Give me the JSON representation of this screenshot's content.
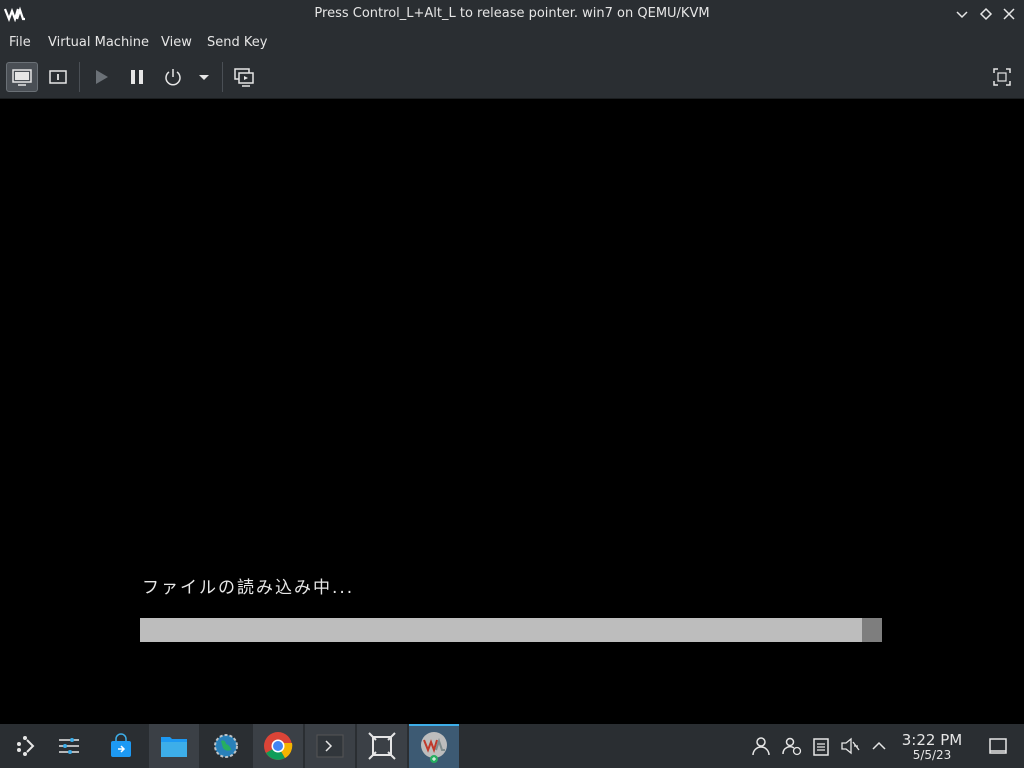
{
  "window": {
    "title": "Press Control_L+Alt_L to release pointer. win7 on QEMU/KVM",
    "app_icon": "virt-manager-icon",
    "controls": [
      "minimize-icon",
      "maximize-icon",
      "close-icon"
    ]
  },
  "menubar": {
    "items": [
      "File",
      "Virtual Machine",
      "View",
      "Send Key"
    ]
  },
  "toolbar": {
    "buttons": [
      {
        "name": "console-button",
        "icon": "monitor-icon",
        "active": true
      },
      {
        "name": "details-button",
        "icon": "info-icon",
        "active": false
      },
      {
        "name": "run-button",
        "icon": "play-icon",
        "active": false
      },
      {
        "name": "pause-button",
        "icon": "pause-icon",
        "active": false
      },
      {
        "name": "shutdown-button",
        "icon": "power-icon",
        "active": false
      },
      {
        "name": "shutdown-menu-button",
        "icon": "caret-down-icon",
        "active": false
      },
      {
        "name": "snapshots-button",
        "icon": "snapshots-icon",
        "active": false
      },
      {
        "name": "fullscreen-button",
        "icon": "fullscreen-icon",
        "active": false
      }
    ]
  },
  "vm": {
    "loading_text": "ファイルの読み込み中...",
    "progress_fraction": 0.973
  },
  "taskbar": {
    "items": [
      {
        "icon": "app-launcher-icon",
        "state": "normal"
      },
      {
        "icon": "system-settings-icon",
        "state": "normal"
      },
      {
        "icon": "discover-store-icon",
        "state": "normal"
      },
      {
        "icon": "file-manager-icon",
        "state": "open"
      },
      {
        "icon": "network-globe-icon",
        "state": "normal"
      },
      {
        "icon": "chrome-icon",
        "state": "open"
      },
      {
        "icon": "terminal-icon",
        "state": "open"
      },
      {
        "icon": "spectacle-icon",
        "state": "open"
      },
      {
        "icon": "virt-manager-icon",
        "state": "active"
      }
    ],
    "tray": [
      "user-icon",
      "user-switch-icon",
      "clipboard-icon",
      "volume-muted-icon",
      "tray-expand-icon"
    ],
    "clock": {
      "time": "3:22 PM",
      "date": "5/5/23"
    },
    "show_desktop_icon": "show-desktop-icon"
  },
  "colors": {
    "chrome_bg": "#2a2e32",
    "vm_bg": "#000000",
    "progress_fill": "#bdbdbd",
    "progress_track": "#7e7e7e",
    "accent": "#3daee9"
  }
}
